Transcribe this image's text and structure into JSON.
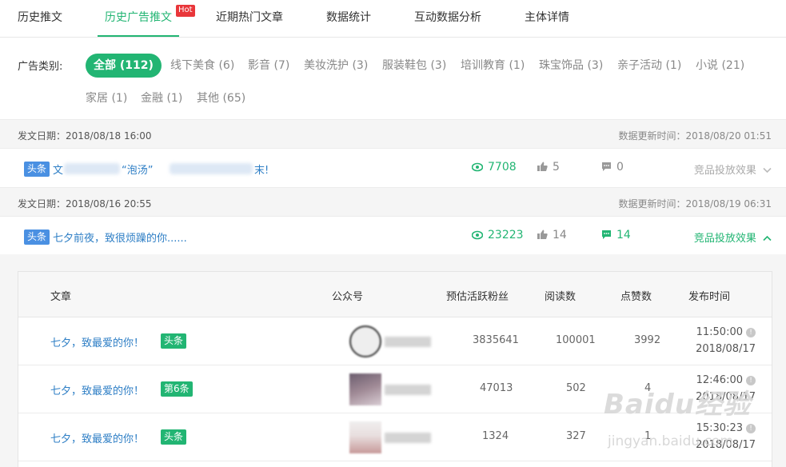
{
  "tabs": [
    {
      "label": "历史推文"
    },
    {
      "label": "历史广告推文",
      "badge": "Hot",
      "active": true
    },
    {
      "label": "近期热门文章"
    },
    {
      "label": "数据统计"
    },
    {
      "label": "互动数据分析"
    },
    {
      "label": "主体详情"
    }
  ],
  "category": {
    "label": "广告类别:",
    "items": [
      {
        "label": "全部 (112)",
        "active": true
      },
      {
        "label": "线下美食 (6)"
      },
      {
        "label": "影音 (7)"
      },
      {
        "label": "美妆洗护 (3)"
      },
      {
        "label": "服装鞋包 (3)"
      },
      {
        "label": "培训教育 (1)"
      },
      {
        "label": "珠宝饰品 (3)"
      },
      {
        "label": "亲子活动 (1)"
      },
      {
        "label": "小说 (21)"
      },
      {
        "label": "家居 (1)"
      },
      {
        "label": "金融 (1)"
      },
      {
        "label": "其他 (65)"
      }
    ]
  },
  "posts": [
    {
      "date": "发文日期：2018/08/18 16:00",
      "updated": "数据更新时间：2018/08/20 01:51",
      "badge": "头条",
      "title_parts": [
        "文",
        "“泡汤”",
        "末!"
      ],
      "reads": "7708",
      "likes": "5",
      "comments": "0",
      "toggle": "竞品投放效果"
    },
    {
      "date": "发文日期：2018/08/16 20:55",
      "updated": "数据更新时间：2018/08/19 06:31",
      "badge": "头条",
      "title": "七夕前夜，致很烦躁的你......",
      "reads": "23223",
      "likes": "14",
      "comments": "14",
      "toggle": "竞品投放效果"
    }
  ],
  "table": {
    "headers": [
      "文章",
      "公众号",
      "预估活跃粉丝",
      "阅读数",
      "点赞数",
      "发布时间"
    ],
    "rows": [
      {
        "title": "七夕，致最爱的你！",
        "badge": "头条",
        "fans": "3835641",
        "reads": "100001",
        "likes": "3992",
        "time": "11:50:00",
        "date": "2018/08/17"
      },
      {
        "title": "七夕，致最爱的你！",
        "badge": "第6条",
        "fans": "47013",
        "reads": "502",
        "likes": "4",
        "time": "12:46:00",
        "date": "2018/08/17"
      },
      {
        "title": "七夕，致最爱的你！",
        "badge": "头条",
        "fans": "1324",
        "reads": "327",
        "likes": "1",
        "time": "15:30:23",
        "date": "2018/08/17"
      }
    ]
  },
  "watermark": {
    "text": "Baidu经验",
    "sub": "jingyan.baidu.com"
  },
  "colors": {
    "accent": "#22b573",
    "link": "#2d7ec5",
    "hot": "#e9363a",
    "badge_blue": "#4a90e2"
  }
}
